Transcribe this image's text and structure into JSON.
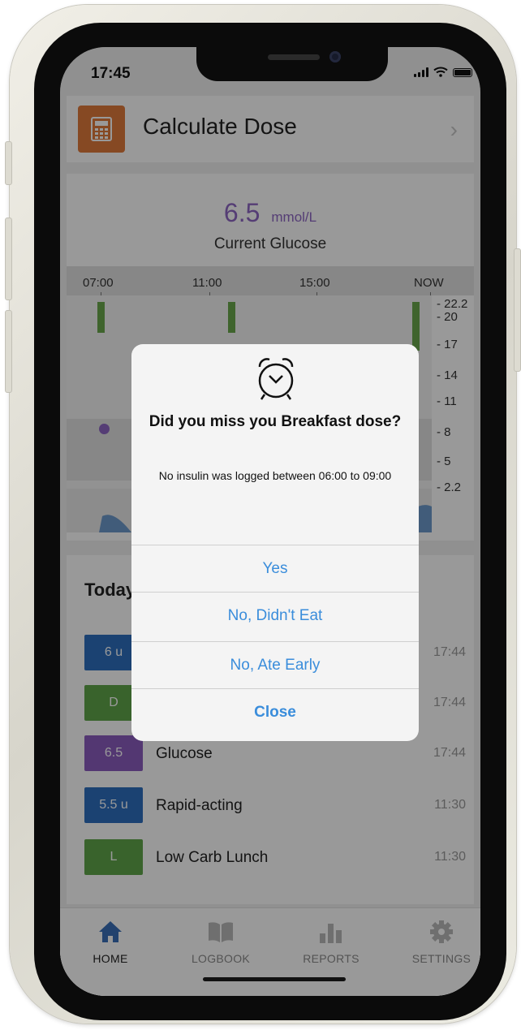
{
  "status": {
    "time": "17:45"
  },
  "calculate": {
    "title": "Calculate Dose",
    "icon": "calculator-icon"
  },
  "glucose": {
    "value": "6.5",
    "unit": "mmol/L",
    "label": "Current Glucose"
  },
  "chart_data": {
    "type": "line",
    "x_ticks": [
      "07:00",
      "11:00",
      "15:00",
      "NOW"
    ],
    "y_ticks": [
      "22.2",
      "20",
      "17",
      "14",
      "11",
      "8",
      "5",
      "2.2"
    ],
    "ylim": [
      2.2,
      22.2
    ],
    "insulin_bars": [
      {
        "time": "07:00"
      },
      {
        "time": "11:30"
      },
      {
        "time": "NOW"
      }
    ],
    "glucose_points": [
      {
        "time": "07:00",
        "value": 6.5
      }
    ]
  },
  "today": {
    "title": "Today",
    "entries": [
      {
        "badge": "6 u",
        "name": "",
        "time": "17:44",
        "color": "#2e6fbf"
      },
      {
        "badge": "D",
        "name": "",
        "time": "17:44",
        "color": "#5fa64a"
      },
      {
        "badge": "6.5",
        "name": "Glucose",
        "time": "17:44",
        "color": "#8a5cbf"
      },
      {
        "badge": "5.5 u",
        "name": "Rapid-acting",
        "time": "11:30",
        "color": "#2e6fbf"
      },
      {
        "badge": "L",
        "name": "Low Carb Lunch",
        "time": "11:30",
        "color": "#5fa64a"
      }
    ]
  },
  "tabs": [
    {
      "label": "HOME",
      "icon": "home-icon",
      "active": true
    },
    {
      "label": "LOGBOOK",
      "icon": "book-icon",
      "active": false
    },
    {
      "label": "REPORTS",
      "icon": "bar-chart-icon",
      "active": false
    },
    {
      "label": "SETTINGS",
      "icon": "gear-icon",
      "active": false
    }
  ],
  "alert": {
    "icon": "alarm-clock-icon",
    "title": "Did you miss you Breakfast dose?",
    "message": "No insulin was logged between 06:00 to 09:00",
    "buttons": {
      "yes": "Yes",
      "didnt_eat": "No, Didn't Eat",
      "ate_early": "No, Ate Early",
      "close": "Close"
    }
  },
  "colors": {
    "accent_blue": "#3a8ddb",
    "calc_orange": "#e07a3b",
    "glucose_purple": "#8e67c3",
    "insulin_green": "#6aa74b",
    "mmol_blue": "#2e6fbf"
  }
}
